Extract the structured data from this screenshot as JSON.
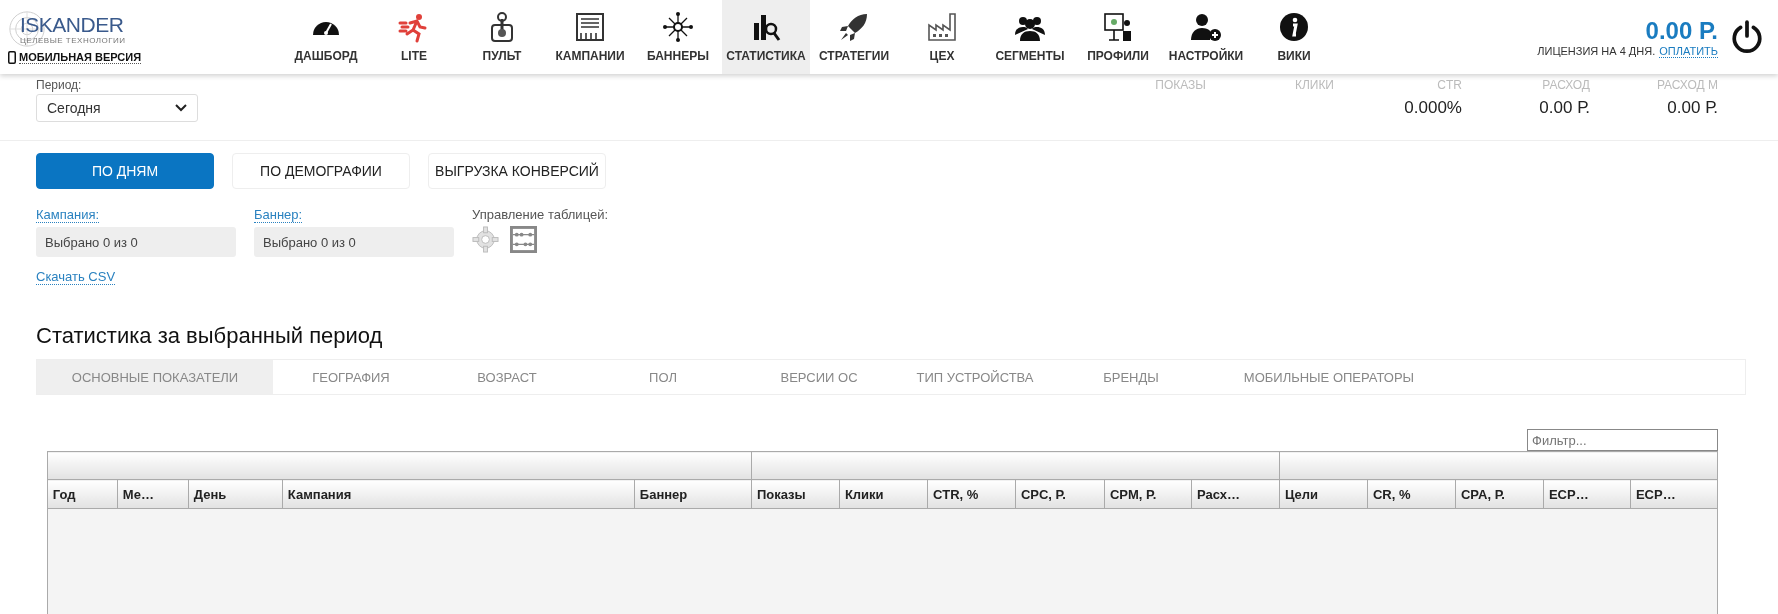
{
  "header": {
    "logo": "ISKANDER",
    "tagline": "ЦЕЛЕВЫЕ ТЕХНОЛОГИИ",
    "mobile_link": "МОБИЛЬНАЯ ВЕРСИЯ",
    "nav": [
      {
        "label": "ДАШБОРД",
        "kind": "gauge",
        "selected": false
      },
      {
        "label": "LITE",
        "kind": "runner",
        "selected": false
      },
      {
        "label": "ПУЛЬТ",
        "kind": "joystick",
        "selected": false
      },
      {
        "label": "КАМПАНИИ",
        "kind": "board",
        "selected": false
      },
      {
        "label": "БАННЕРЫ",
        "kind": "network",
        "selected": false
      },
      {
        "label": "СТАТИСТИКА",
        "kind": "chart",
        "selected": true
      },
      {
        "label": "СТРАТЕГИИ",
        "kind": "rocket",
        "selected": false
      },
      {
        "label": "ЦЕХ",
        "kind": "factory",
        "selected": false
      },
      {
        "label": "СЕГМЕНТЫ",
        "kind": "people",
        "selected": false
      },
      {
        "label": "ПРОФИЛИ",
        "kind": "presenter",
        "selected": false
      },
      {
        "label": "НАСТРОЙКИ",
        "kind": "user",
        "selected": false
      },
      {
        "label": "ВИКИ",
        "kind": "info",
        "selected": false
      }
    ],
    "balance": "0.00 Р.",
    "license": "ЛИЦЕНЗИЯ НА 4 ДНЯ.",
    "pay_link": "ОПЛАТИТЬ"
  },
  "period": {
    "label": "Период:",
    "value": "Сегодня"
  },
  "metrics": [
    {
      "label": "ПОКАЗЫ"
    },
    {
      "label": "КЛИКИ"
    },
    {
      "label": "CTR",
      "value": "0.000%"
    },
    {
      "label": "РАСХОД",
      "value": "0.00 Р."
    },
    {
      "label": "РАСХОД М",
      "value": "0.00 Р."
    }
  ],
  "modes": [
    {
      "label": "ПО ДНЯМ",
      "selected": true
    },
    {
      "label": "ПО ДЕМОГРАФИИ",
      "selected": false
    },
    {
      "label": "ВЫГРУЗКА КОНВЕРСИЙ",
      "selected": false
    }
  ],
  "filters": [
    {
      "label": "Кампания:",
      "value": "Выбрано 0 из 0"
    },
    {
      "label": "Баннер:",
      "value": "Выбрано 0 из 0"
    }
  ],
  "table_controls_label": "Управление таблицей:",
  "download_link": "Скачать CSV",
  "section_title": "Статистика за выбранный период",
  "tabs": [
    {
      "label": "ОСНОВНЫЕ ПОКАЗАТЕЛИ",
      "selected": true
    },
    {
      "label": "ГЕОГРАФИЯ",
      "selected": false
    },
    {
      "label": "ВОЗРАСТ",
      "selected": false
    },
    {
      "label": "ПОЛ",
      "selected": false
    },
    {
      "label": "ВЕРСИИ ОС",
      "selected": false
    },
    {
      "label": "ТИП УСТРОЙСТВА",
      "selected": false
    },
    {
      "label": "БРЕНДЫ",
      "selected": false
    },
    {
      "label": "МОБИЛЬНЫЕ ОПЕРАТОРЫ",
      "selected": false
    }
  ],
  "filter_field": {
    "placeholder": "Фильтр..."
  },
  "table": {
    "columns": [
      "Год",
      "Ме…",
      "День",
      "Кампания",
      "Баннер",
      "Показы",
      "Клики",
      "CTR, %",
      "CPC, Р.",
      "CPM, Р.",
      "Расх…",
      "Цели",
      "CR, %",
      "CPA, Р.",
      "ECP…",
      "ECP…"
    ]
  }
}
